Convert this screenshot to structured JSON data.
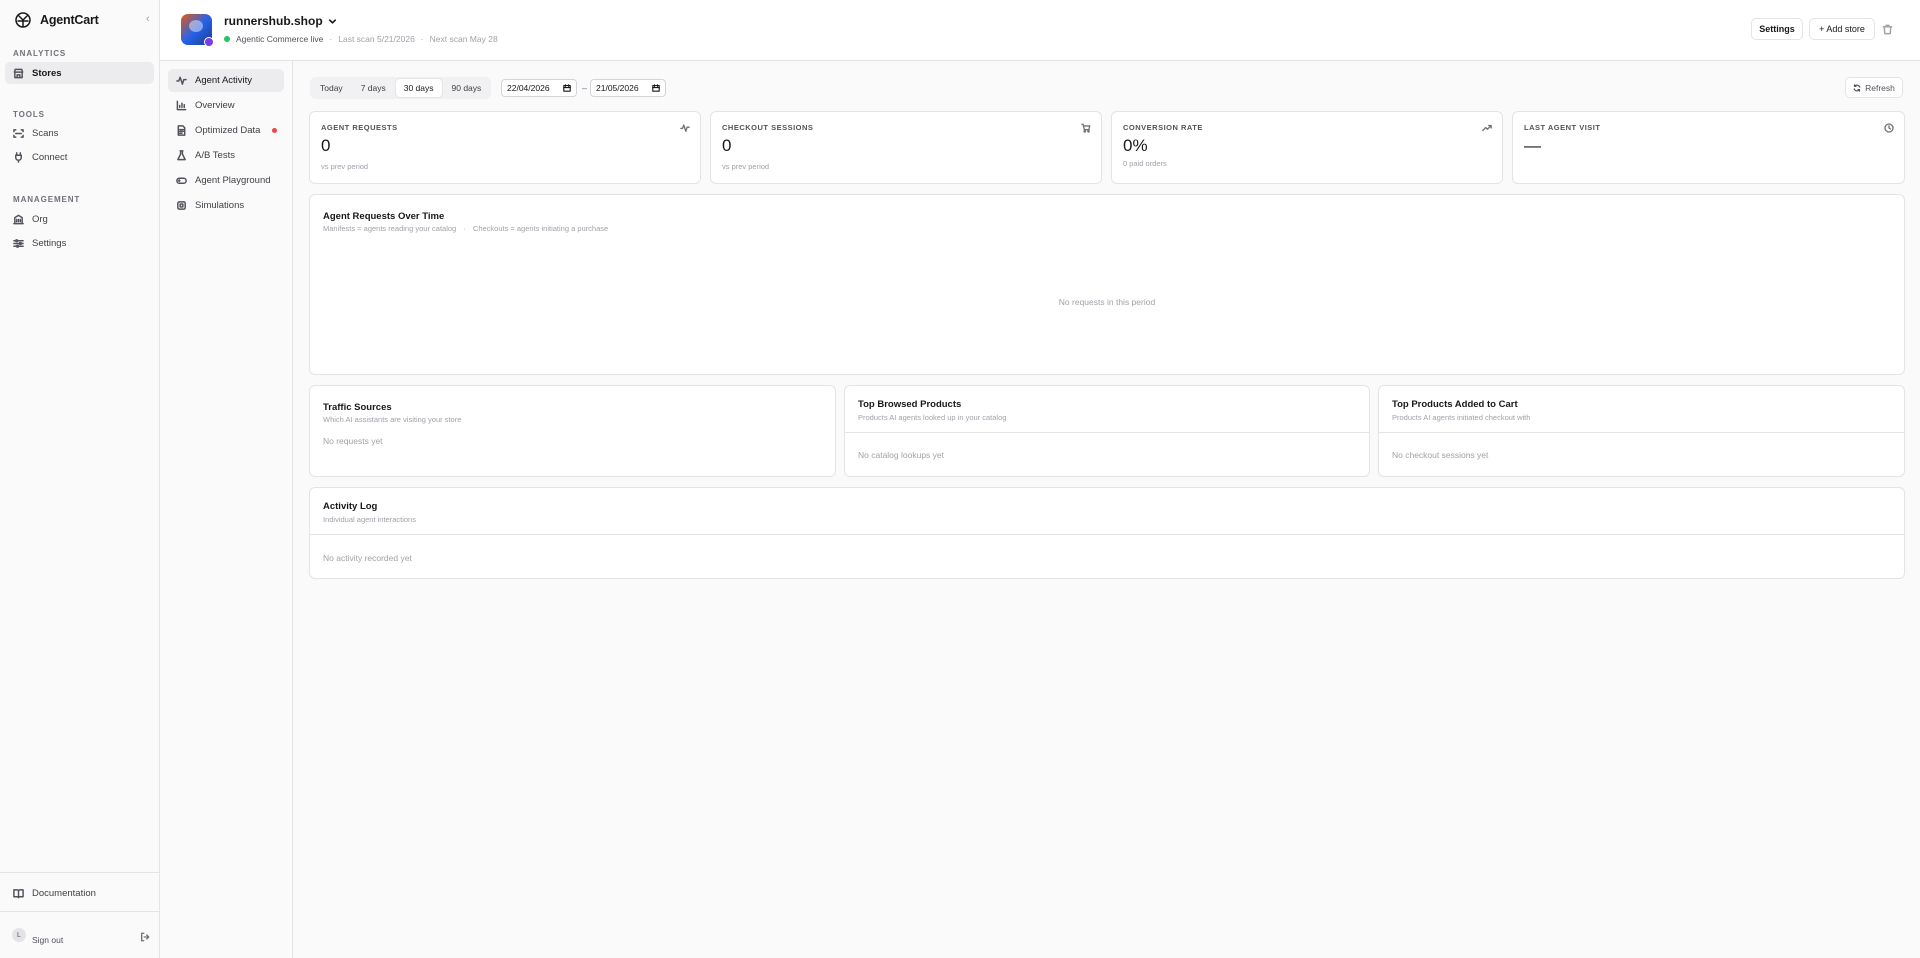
{
  "brand": {
    "name": "AgentCart",
    "collapse_icon": "chevron-left-icon"
  },
  "sidebar": {
    "sections": [
      {
        "label": "ANALYTICS",
        "items": [
          {
            "label": "Stores",
            "icon": "store-icon",
            "active": true
          }
        ]
      },
      {
        "label": "TOOLS",
        "items": [
          {
            "label": "Scans",
            "icon": "scan-icon"
          },
          {
            "label": "Connect",
            "icon": "plug-icon"
          }
        ]
      },
      {
        "label": "MANAGEMENT",
        "items": [
          {
            "label": "Org",
            "icon": "building-icon"
          },
          {
            "label": "Settings",
            "icon": "sliders-icon"
          }
        ]
      }
    ],
    "documentation": "Documentation",
    "avatar_initial": "L",
    "sign_out": "Sign out"
  },
  "header": {
    "store_name": "runnershub.shop",
    "status": "Agentic Commerce live",
    "last_scan": "Last scan 5/21/2026",
    "separator": "·",
    "next_scan": "Next scan May 28",
    "settings_button": "Settings",
    "add_store_button": "+ Add store"
  },
  "subnav": {
    "items": [
      {
        "label": "Agent Activity",
        "icon": "activity-icon",
        "active": true
      },
      {
        "label": "Overview",
        "icon": "bar-chart-icon"
      },
      {
        "label": "Optimized Data",
        "icon": "document-icon",
        "alert": true
      },
      {
        "label": "A/B Tests",
        "icon": "flask-icon"
      },
      {
        "label": "Agent Playground",
        "icon": "gamepad-icon"
      },
      {
        "label": "Simulations",
        "icon": "chip-icon"
      }
    ]
  },
  "filters": {
    "ranges": [
      "Today",
      "7 days",
      "30 days",
      "90 days"
    ],
    "active_range": "30 days",
    "date_from": "22/04/2026",
    "date_separator": "–",
    "date_to": "21/05/2026",
    "refresh": "Refresh"
  },
  "stats": [
    {
      "label": "AGENT REQUESTS",
      "value": "0",
      "sub": "vs prev period",
      "icon": "activity-icon"
    },
    {
      "label": "CHECKOUT SESSIONS",
      "value": "0",
      "sub": "vs prev period",
      "icon": "cart-icon"
    },
    {
      "label": "CONVERSION RATE",
      "value": "0%",
      "sub": "0 paid orders",
      "icon": "trending-up-icon"
    },
    {
      "label": "LAST AGENT VISIT",
      "value": "—",
      "sub": "",
      "icon": "clock-icon"
    }
  ],
  "requests_chart": {
    "title": "Agent Requests Over Time",
    "subtitle_a": "Manifests = agents reading your catalog",
    "subtitle_sep": "·",
    "subtitle_b": "Checkouts = agents initiating a purchase",
    "empty": "No requests in this period"
  },
  "traffic": {
    "title": "Traffic Sources",
    "subtitle": "Which AI assistants are visiting your store",
    "empty": "No requests yet"
  },
  "browsed": {
    "title": "Top Browsed Products",
    "subtitle": "Products AI agents looked up in your catalog",
    "empty": "No catalog lookups yet"
  },
  "carted": {
    "title": "Top Products Added to Cart",
    "subtitle": "Products AI agents initiated checkout with",
    "empty": "No checkout sessions yet"
  },
  "activity_log": {
    "title": "Activity Log",
    "subtitle": "Individual agent interactions",
    "empty": "No activity recorded yet"
  }
}
